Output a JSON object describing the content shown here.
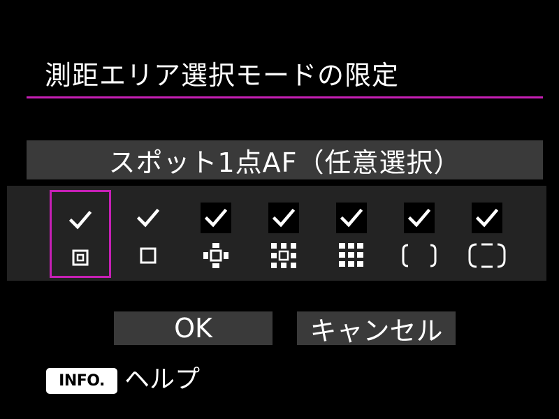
{
  "title": "測距エリア選択モードの限定",
  "mode_label": "スポット1点AF（任意選択）",
  "area_modes": [
    {
      "icon": "spot-af-icon",
      "checked": true,
      "selected": true
    },
    {
      "icon": "single-point-af-icon",
      "checked": true,
      "selected": false
    },
    {
      "icon": "af-point-expansion-icon",
      "checked": true,
      "selected": false
    },
    {
      "icon": "af-point-expansion-surround-icon",
      "checked": true,
      "selected": false
    },
    {
      "icon": "zone-af-icon",
      "checked": true,
      "selected": false
    },
    {
      "icon": "large-zone-af-icon",
      "checked": true,
      "selected": false
    },
    {
      "icon": "auto-selection-af-icon",
      "checked": true,
      "selected": false
    }
  ],
  "buttons": {
    "ok": "OK",
    "cancel": "キャンセル"
  },
  "footer": {
    "info_key": "INFO.",
    "help": "ヘルプ"
  },
  "colors": {
    "accent": "#c61fb5",
    "bar": "#3a3a3a",
    "panel": "#232323"
  }
}
